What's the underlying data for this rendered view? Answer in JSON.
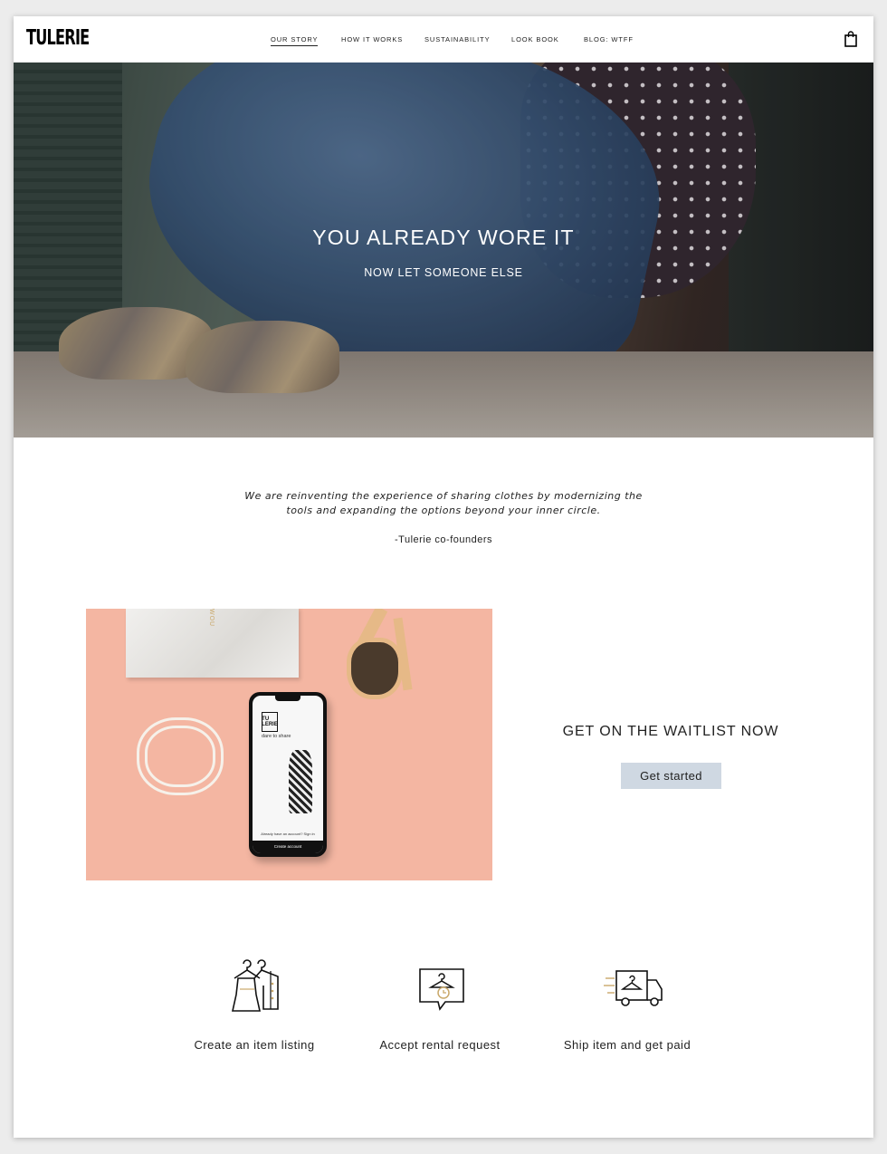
{
  "header": {
    "logo": "TULERIE",
    "nav": [
      {
        "label": "OUR STORY",
        "active": true
      },
      {
        "label": "HOW IT WORKS",
        "active": false
      },
      {
        "label": "SUSTAINABILITY",
        "active": false
      },
      {
        "label": "LOOK BOOK",
        "active": false
      },
      {
        "label": "BLOG: WTFF",
        "active": false
      }
    ],
    "cart_icon": "shopping-bag-icon"
  },
  "hero": {
    "title": "YOU ALREADY WORE IT",
    "subtitle": "NOW LET SOMEONE ELSE"
  },
  "quote": {
    "line1": "We are reinventing the experience of sharing clothes by modernizing the",
    "line2": "tools and expanding the options beyond your inner circle.",
    "author": "-Tulerie co-founders"
  },
  "promo_image": {
    "phone_logo": "TU LERIE",
    "phone_tagline": "dare to share",
    "phone_account_text": "Already have an account? Sign in",
    "phone_button": "Create account",
    "notebook_text": "WOU"
  },
  "waitlist": {
    "title": "GET ON THE WAITLIST NOW",
    "button": "Get started"
  },
  "steps": [
    {
      "icon": "clothes-hanger-icon",
      "label": "Create an item listing"
    },
    {
      "icon": "rental-request-icon",
      "label": "Accept rental request"
    },
    {
      "icon": "delivery-truck-icon",
      "label": "Ship item and get paid"
    }
  ],
  "colors": {
    "accent_gold": "#c9a86a",
    "cta_background": "#cfd8e2",
    "photo_background": "#f4b6a2"
  }
}
